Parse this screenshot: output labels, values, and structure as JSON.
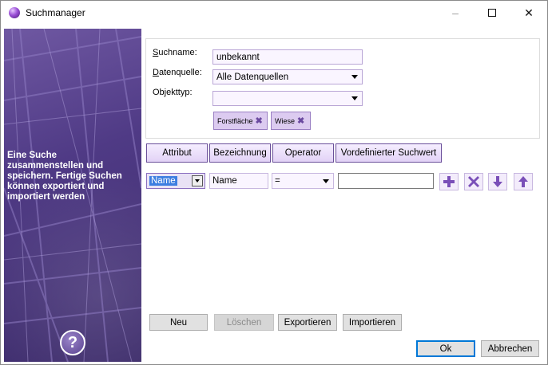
{
  "window": {
    "title": "Suchmanager",
    "minimize": "–",
    "close": "✕"
  },
  "banner": {
    "text": "Eine Suche zusammenstellen und speichern. Fertige Suchen können exportiert und importiert werden",
    "help": "?"
  },
  "form": {
    "suchname_label_u": "S",
    "suchname_label_rest": "uchname:",
    "suchname_value": "unbekannt",
    "datenquelle_label_u": "D",
    "datenquelle_label_rest": "atenquelle:",
    "datenquelle_value": "Alle Datenquellen",
    "objekttyp_label": "Objekttyp:",
    "objekttyp_value": "",
    "chips": [
      "Forstfläche",
      "Wiese"
    ],
    "chip_remove": "✖"
  },
  "columns": {
    "attribut": "Attribut",
    "bezeichnung": "Bezeichnung",
    "operator": "Operator",
    "vordefiniert": "Vordefinierter Suchwert"
  },
  "criteria_row": {
    "attribut": "Name",
    "bezeichnung": "Name",
    "operator": "=",
    "wert": ""
  },
  "buttons": {
    "neu": "Neu",
    "loeschen": "Löschen",
    "exportieren": "Exportieren",
    "importieren": "Importieren",
    "ok": "Ok",
    "abbrechen": "Abbrechen"
  },
  "colors": {
    "accent": "#6a4f9a",
    "chip_bg": "#dccbf0",
    "banner": "#4f3a85",
    "icon": "#7a4fb8"
  },
  "icons": [
    "app-icon",
    "minimize-icon",
    "maximize-icon",
    "close-icon",
    "help-icon",
    "dropdown-arrow-icon",
    "chip-remove-icon",
    "add-icon",
    "delete-icon",
    "move-down-icon",
    "move-up-icon"
  ]
}
